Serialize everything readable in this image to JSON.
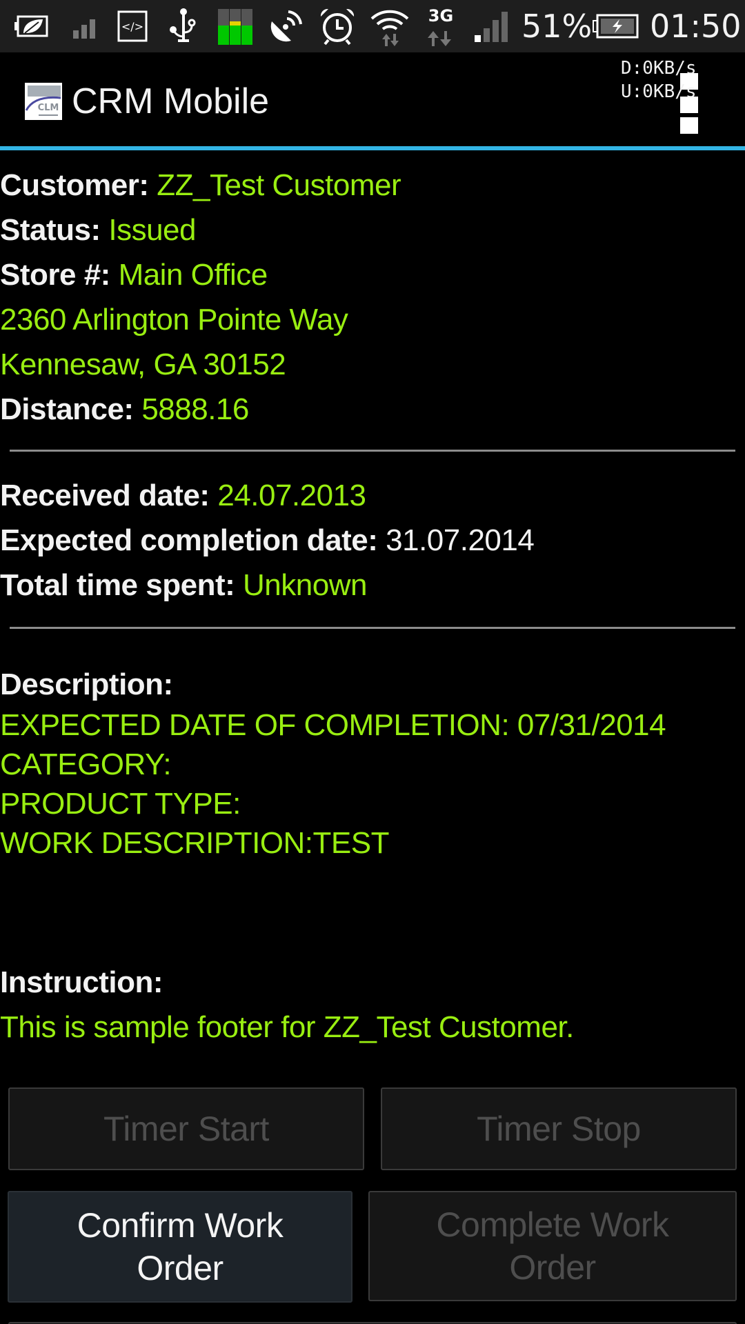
{
  "status_bar": {
    "icons": [
      "eco-battery-icon",
      "signal-weak-icon",
      "developer-code-icon",
      "usb-debug-icon",
      "equalizer-icon",
      "satellite-dish-icon",
      "alarm-clock-icon",
      "wifi-icon",
      "3g-data-icon",
      "cell-signal-icon"
    ],
    "network_type": "3G",
    "battery_percent": "51%",
    "time": "01:50",
    "colors": {
      "background": "#1e1e1e",
      "equalizer_green": "#00c800",
      "equalizer_yellow": "#e6d200"
    }
  },
  "action_bar": {
    "logo_text": "CLM",
    "title": "CRM Mobile",
    "net_speed": {
      "download": "D:0KB/s",
      "upload": "U:0KB/s"
    },
    "accent_color": "#33b5e5"
  },
  "details": {
    "customer": {
      "label": "Customer:",
      "value": "ZZ_Test Customer"
    },
    "status": {
      "label": "Status:",
      "value": "Issued"
    },
    "store": {
      "label": "Store #:",
      "value": "Main Office"
    },
    "address_line1": "2360 Arlington Pointe Way",
    "address_line2": "Kennesaw, GA 30152",
    "distance": {
      "label": "Distance:",
      "value": "5888.16"
    }
  },
  "dates": {
    "received": {
      "label": "Received date:",
      "value": "24.07.2013"
    },
    "expected": {
      "label": "Expected completion date:",
      "value": "31.07.2014"
    },
    "time_spent": {
      "label": "Total time spent:",
      "value": "Unknown"
    }
  },
  "description": {
    "label": "Description:",
    "lines": [
      "EXPECTED DATE OF COMPLETION: 07/31/2014",
      "CATEGORY:",
      "PRODUCT TYPE:",
      "WORK DESCRIPTION:TEST"
    ]
  },
  "instruction": {
    "label": "Instruction:",
    "text": "This is sample footer for ZZ_Test Customer."
  },
  "buttons": {
    "timer_start": "Timer Start",
    "timer_stop": "Timer Stop",
    "confirm_line1": "Confirm Work",
    "confirm_line2": "Order",
    "complete_line1": "Complete Work",
    "complete_line2": "Order"
  },
  "colors": {
    "value_green": "#99ee11",
    "label_white": "#f2f2f2",
    "disabled_text": "#4e4e4e"
  }
}
